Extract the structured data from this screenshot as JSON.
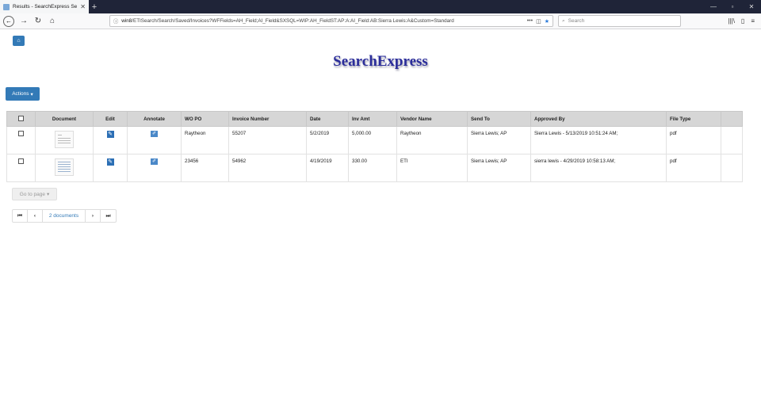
{
  "browser": {
    "tab_title": "Results - SearchExpress Search",
    "tab_close": "✕",
    "new_tab": "+",
    "url_host": "win8",
    "url_path": "/ETISearch/Search/Saved/Invoices?WFFields=AH_Field;AI_Field&SXSQL=WIP:AH_FieldST:AP:A:AI_Field:AB:Sierra Lewis:A&Custom=Standard",
    "search_placeholder": "Search",
    "win_min": "—",
    "win_max": "▫",
    "win_close": "✕"
  },
  "page": {
    "logo": "SearchExpress",
    "actions_label": "Actions",
    "goto_page_label": "Go to page",
    "pager_info": "2 documents"
  },
  "table": {
    "headers": [
      "Document",
      "Edit",
      "Annotate",
      "WO PO",
      "Invoice Number",
      "Date",
      "Inv Amt",
      "Vendor Name",
      "Send To",
      "Approved By",
      "File Type"
    ],
    "rows": [
      {
        "wo_po": "Raytheon",
        "invoice_number": "55207",
        "date": "5/2/2019",
        "inv_amt": "5,000.00",
        "vendor": "Raytheon",
        "send_to": "Sierra Lewis; AP",
        "approved_by": "Sierra Lewis - 5/13/2019 10:51:24 AM;",
        "file_type": "pdf"
      },
      {
        "wo_po": "23456",
        "invoice_number": "54962",
        "date": "4/19/2019",
        "inv_amt": "330.00",
        "vendor": "ETI",
        "send_to": "Sierra Lewis; AP",
        "approved_by": "sierra lewis - 4/29/2019 10:58:13 AM;",
        "file_type": "pdf"
      }
    ]
  },
  "colors": {
    "primary": "#337ab7",
    "logo": "#2b2d9a",
    "header_bg": "#d6d6d6"
  }
}
